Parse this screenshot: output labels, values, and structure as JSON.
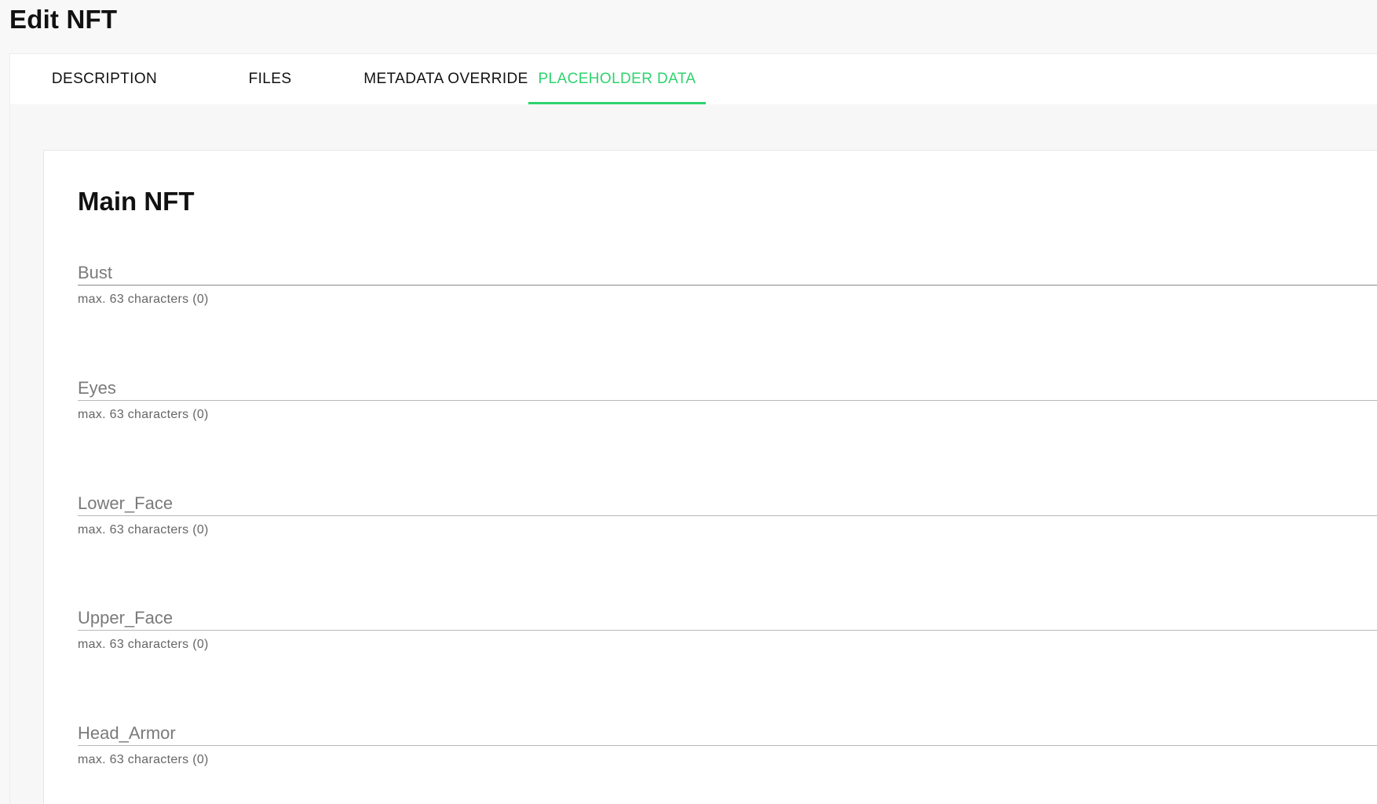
{
  "page": {
    "title": "Edit NFT"
  },
  "tabs": [
    {
      "label": "DESCRIPTION"
    },
    {
      "label": "FILES"
    },
    {
      "label": "METADATA OVERRIDE"
    },
    {
      "label": "PLACEHOLDER DATA"
    }
  ],
  "active_tab": "PLACEHOLDER DATA",
  "colors": {
    "accent": "#2fd36d"
  },
  "card": {
    "title": "Main NFT",
    "fields": [
      {
        "placeholder": "Bust",
        "value": "",
        "hint": "max. 63 characters (0)"
      },
      {
        "placeholder": "Eyes",
        "value": "",
        "hint": "max. 63 characters (0)"
      },
      {
        "placeholder": "Lower_Face",
        "value": "",
        "hint": "max. 63 characters (0)"
      },
      {
        "placeholder": "Upper_Face",
        "value": "",
        "hint": "max. 63 characters (0)"
      },
      {
        "placeholder": "Head_Armor",
        "value": "",
        "hint": "max. 63 characters (0)"
      }
    ]
  }
}
